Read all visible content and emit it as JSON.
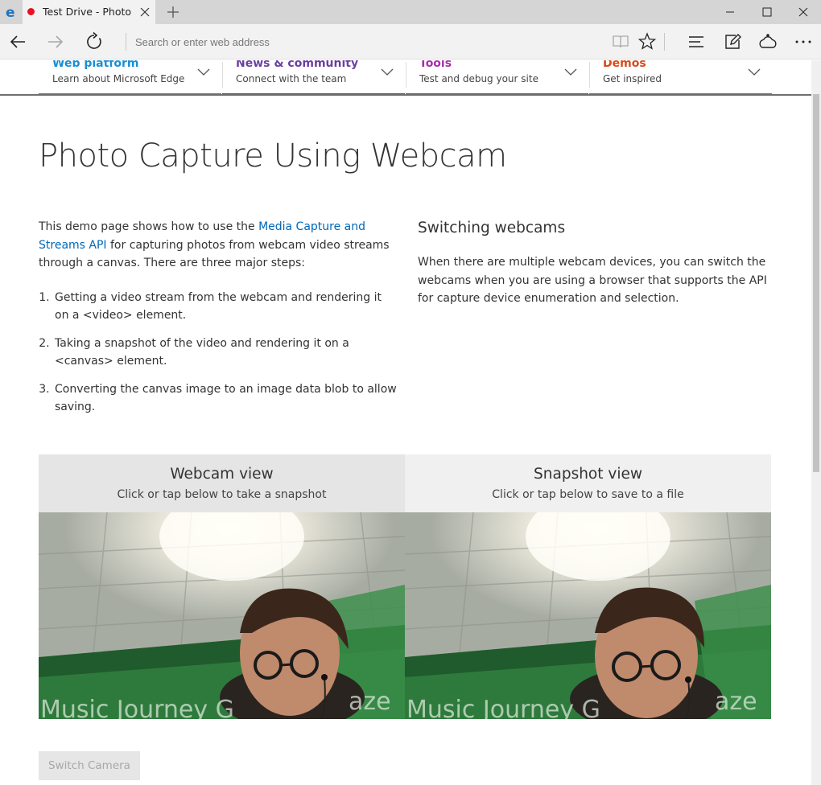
{
  "browser": {
    "tab_title": "Test Drive - Photo C",
    "address_placeholder": "Search or enter web address"
  },
  "site_nav": [
    {
      "title": "Web platform",
      "subtitle": "Learn about Microsoft Edge",
      "color": "#1a8fd6"
    },
    {
      "title": "News & community",
      "subtitle": "Connect with the team",
      "color": "#6b3fa0"
    },
    {
      "title": "Tools",
      "subtitle": "Test and debug your site",
      "color": "#a62fab"
    },
    {
      "title": "Demos",
      "subtitle": "Get inspired",
      "color": "#d84a1b"
    }
  ],
  "page": {
    "title": "Photo Capture Using Webcam",
    "intro_before": "This demo page shows how to use the ",
    "intro_link": "Media Capture and Streams API",
    "intro_after": " for capturing photos from webcam video streams through a canvas. There are three major steps:",
    "steps": [
      "Getting a video stream from the webcam and rendering it on a <video> element.",
      "Taking a snapshot of the video and rendering it on a <canvas> element.",
      "Converting the canvas image to an image data blob to allow saving."
    ],
    "switching_heading": "Switching webcams",
    "switching_text": "When there are multiple webcam devices, you can switch the webcams when you are using a browser that supports the API for capture device enumeration and selection."
  },
  "webcam_view": {
    "title": "Webcam view",
    "subtitle": "Click or tap below to take a snapshot"
  },
  "snapshot_view": {
    "title": "Snapshot view",
    "subtitle": "Click or tap below to save to a file"
  },
  "switch_camera_label": "Switch Camera",
  "colors": {
    "link": "#0067b8",
    "tab_dot": "#e81123",
    "edge_logo": "#1e73be"
  }
}
